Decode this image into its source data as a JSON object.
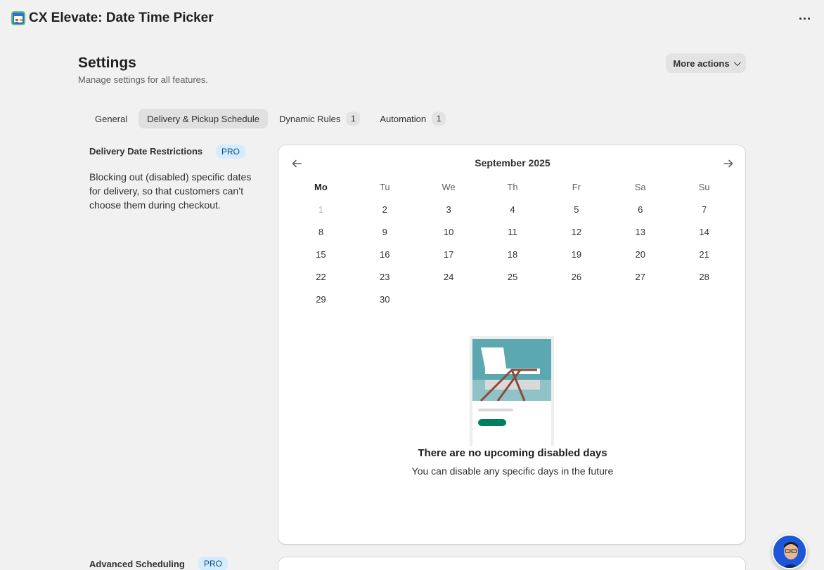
{
  "app": {
    "title": "CX Elevate: Date Time Picker",
    "icon": "calendar-app-icon"
  },
  "page": {
    "title": "Settings",
    "subtitle": "Manage settings for all features.",
    "more_actions_label": "More actions"
  },
  "tabs": [
    {
      "label": "General",
      "badge": ""
    },
    {
      "label": "Delivery & Pickup Schedule",
      "badge": ""
    },
    {
      "label": "Dynamic Rules",
      "badge": "1"
    },
    {
      "label": "Automation",
      "badge": "1"
    }
  ],
  "active_tab": "Delivery & Pickup Schedule",
  "restrictions": {
    "title": "Delivery Date Restrictions",
    "badge": "PRO",
    "description": "Blocking out (disabled) specific dates for delivery, so that customers can’t choose them during checkout."
  },
  "calendar": {
    "month": "September 2025",
    "weekdays": [
      "Mo",
      "Tu",
      "We",
      "Th",
      "Fr",
      "Sa",
      "Su"
    ],
    "weeks": [
      [
        "1",
        "2",
        "3",
        "4",
        "5",
        "6",
        "7"
      ],
      [
        "8",
        "9",
        "10",
        "11",
        "12",
        "13",
        "14"
      ],
      [
        "15",
        "16",
        "17",
        "18",
        "19",
        "20",
        "21"
      ],
      [
        "22",
        "23",
        "24",
        "25",
        "26",
        "27",
        "28"
      ],
      [
        "29",
        "30",
        "",
        "",
        "",
        "",
        ""
      ]
    ],
    "muted_day": "1"
  },
  "empty_state": {
    "title": "There are no upcoming disabled days",
    "subtitle": "You can disable any specific days in the future"
  },
  "advanced": {
    "title": "Advanced Scheduling",
    "badge": "PRO"
  },
  "colors": {
    "accent_green": "#007f5f",
    "pro_bg": "#d5ebff",
    "pro_text": "#00527c",
    "illus_teal": "#5ba8b0"
  }
}
